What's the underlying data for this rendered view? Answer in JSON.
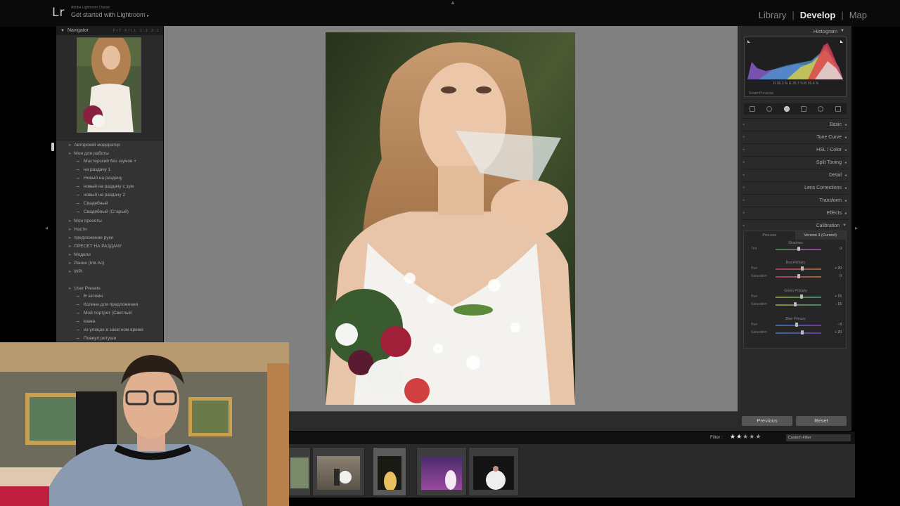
{
  "app": {
    "logo": "Lr",
    "subtitle": "Adobe Lightroom Classic",
    "title": "Get started with Lightroom",
    "title_arrow": "▸"
  },
  "modules": [
    {
      "label": "Library",
      "active": false
    },
    {
      "label": "Develop",
      "active": true
    },
    {
      "label": "Map",
      "active": false
    }
  ],
  "left_panel": {
    "navigator_title": "Navigator",
    "navigator_zoom": "FIT  FILL  1:1  3:1",
    "presets": [
      {
        "label": "Авторский модератор",
        "type": "folder"
      },
      {
        "label": "Мои для работы",
        "type": "folder"
      },
      {
        "label": "Мастерский без шумов +",
        "type": "item"
      },
      {
        "label": "на раздачу 1",
        "type": "item"
      },
      {
        "label": "Новый на раздачу",
        "type": "item"
      },
      {
        "label": "новый на раздачу с зум",
        "type": "item"
      },
      {
        "label": "новый на раздачу 2",
        "type": "item"
      },
      {
        "label": "Свадебный",
        "type": "item"
      },
      {
        "label": "Свадебный (Старый)",
        "type": "item"
      },
      {
        "label": "Мои пресеты",
        "type": "folder"
      },
      {
        "label": "Настя",
        "type": "folder"
      },
      {
        "label": "предложение руки",
        "type": "folder"
      },
      {
        "label": "ПРЕСЕТ НА РАЗДАЧУ",
        "type": "folder"
      },
      {
        "label": "Модели",
        "type": "folder"
      },
      {
        "label": "Ранее (Intr.Ac)",
        "type": "folder"
      },
      {
        "label": "WPI",
        "type": "folder"
      },
      {
        "label": "User Presets",
        "type": "folder"
      },
      {
        "label": "В затемн",
        "type": "item"
      },
      {
        "label": "Колинн для предложения",
        "type": "item"
      },
      {
        "label": "Мой портрет (Светлый",
        "type": "item"
      },
      {
        "label": "мама",
        "type": "item"
      },
      {
        "label": "из улицах в закатном время",
        "type": "item"
      },
      {
        "label": "Повеул ретуши",
        "type": "item"
      }
    ]
  },
  "right_panel": {
    "histogram_title": "Histogram",
    "histogram_values": "R  36.3  %   G  35.7  %   B  36.4  %",
    "smart_previews": "Smart Previews",
    "sections": [
      "Basic",
      "Tone Curve",
      "HSL / Color",
      "Split Toning",
      "Detail",
      "Lens Corrections",
      "Transform",
      "Effects",
      "Calibration"
    ],
    "calibration": {
      "tabs": [
        "Process",
        "Version 3 (Current)"
      ],
      "groups": [
        {
          "title": "Shadows",
          "sliders": [
            {
              "label": "Tint",
              "value": "0",
              "pos": 0.5
            }
          ]
        },
        {
          "title": "Red Primary",
          "sliders": [
            {
              "label": "Hue",
              "value": "+ 20",
              "pos": 0.58
            },
            {
              "label": "Saturation",
              "value": "0",
              "pos": 0.5
            }
          ]
        },
        {
          "title": "Green Primary",
          "sliders": [
            {
              "label": "Hue",
              "value": "+ 15",
              "pos": 0.57
            },
            {
              "label": "Saturation",
              "value": "- 15",
              "pos": 0.43
            }
          ]
        },
        {
          "title": "Blue Primary",
          "sliders": [
            {
              "label": "Hue",
              "value": "- 8",
              "pos": 0.46
            },
            {
              "label": "Saturation",
              "value": "+ 20",
              "pos": 0.58
            }
          ]
        }
      ]
    },
    "previous_label": "Previous",
    "reset_label": "Reset"
  },
  "filter": {
    "label": "Filter :",
    "rating": 2,
    "max_rating": 5,
    "custom_filter": "Custom Filter"
  },
  "colors": {
    "bg": "#000000",
    "panel": "#2a2a2a",
    "canvas": "#808080",
    "active_module": "#e8e8e8"
  }
}
